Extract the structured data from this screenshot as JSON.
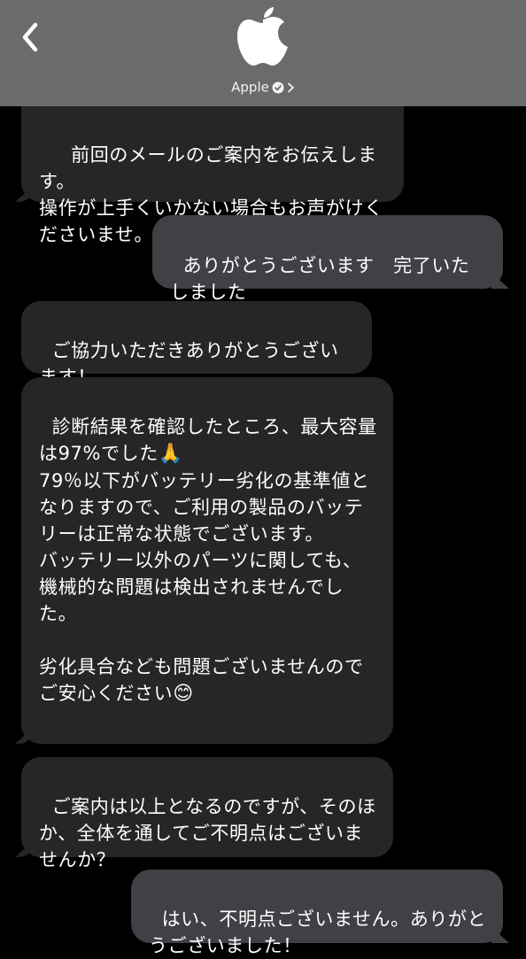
{
  "header": {
    "contact_name": "Apple",
    "bg_color": "#6b6b6b"
  },
  "messages": [
    {
      "from": "business",
      "text": "　前回のメールのご案内をお伝えします。\n操作が上手くいかない場合もお声がけくださいませ。"
    },
    {
      "from": "me",
      "text": "ありがとうございます　完了いたしました"
    },
    {
      "from": "business",
      "text": "ご協力いただきありがとうございます！"
    },
    {
      "from": "business",
      "text_parts": [
        "診断結果を確認したところ、最大容量は97%でした",
        "🙏",
        "\n79％以下がバッテリー劣化の基準値となりますので、ご利用の製品のバッテリーは正常な状態でございます。\nバッテリー以外のパーツに関しても、機械的な問題は検出されませんでした。\n\n劣化具合なども問題ございませんのでご安心ください",
        "😊"
      ]
    },
    {
      "from": "business",
      "text": "ご案内は以上となるのですが、そのほか、全体を通してご不明点はございませんか？"
    },
    {
      "from": "me",
      "text": "はい、不明点ございません。ありがとうございました！"
    }
  ],
  "icons": {
    "back": "chevron-left-icon",
    "avatar": "apple-logo-icon",
    "verified": "verified-badge-icon",
    "disclosure": "chevron-right-icon"
  },
  "colors": {
    "incoming_bubble": "#262628",
    "outgoing_bubble": "#3f4145",
    "background": "#000000"
  }
}
